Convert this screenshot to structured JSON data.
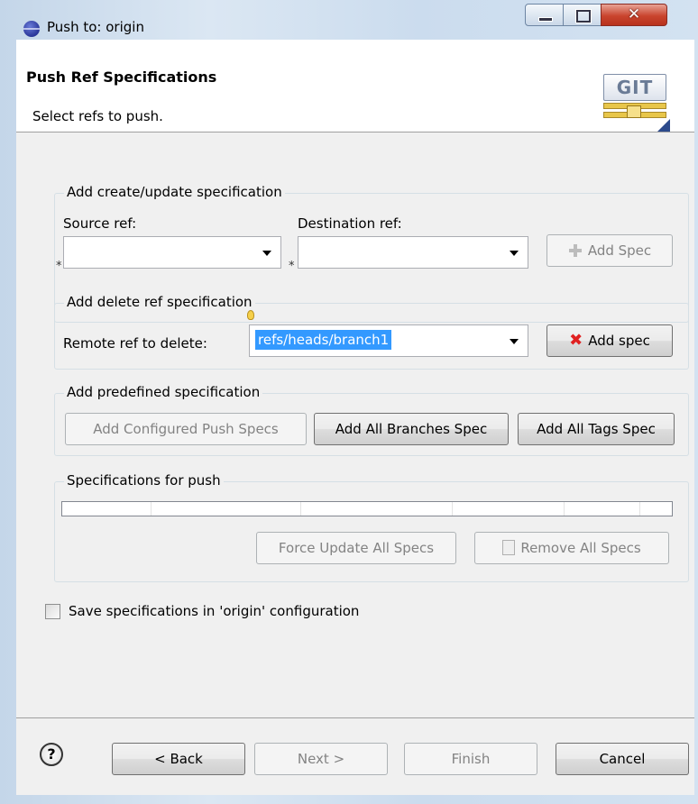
{
  "window": {
    "title": "Push to: origin"
  },
  "banner": {
    "title": "Push Ref Specifications",
    "subtitle": "Select refs to push.",
    "logo_text": "GIT"
  },
  "create_group": {
    "title": "Add create/update specification",
    "source_label": "Source ref:",
    "destination_label": "Destination ref:",
    "source_value": "",
    "destination_value": "",
    "required_marker": "*",
    "add_button": "Add Spec"
  },
  "delete_group": {
    "title": "Add delete ref specification",
    "remote_label": "Remote ref to delete:",
    "remote_value": "refs/heads/branch1",
    "add_button": "Add spec"
  },
  "predefined_group": {
    "title": "Add predefined specification",
    "configured_button": "Add Configured Push Specs",
    "branches_button": "Add All Branches Spec",
    "tags_button": "Add All Tags Spec"
  },
  "specs_group": {
    "title": "Specifications for push",
    "force_update_button": "Force Update All Specs",
    "remove_button": "Remove All Specs"
  },
  "save_option": {
    "label": "Save specifications in 'origin' configuration",
    "checked": false
  },
  "footer": {
    "help": "?",
    "back": "< Back",
    "next": "Next >",
    "finish": "Finish",
    "cancel": "Cancel"
  },
  "colors": {
    "selection": "#3399ff",
    "delete_icon": "#e02020",
    "close_button": "#c9442e"
  },
  "icons": {
    "window": "eclipse-icon",
    "add": "plus-icon",
    "delete": "red-x-icon",
    "remove": "remove-page-icon",
    "help": "question-icon"
  }
}
